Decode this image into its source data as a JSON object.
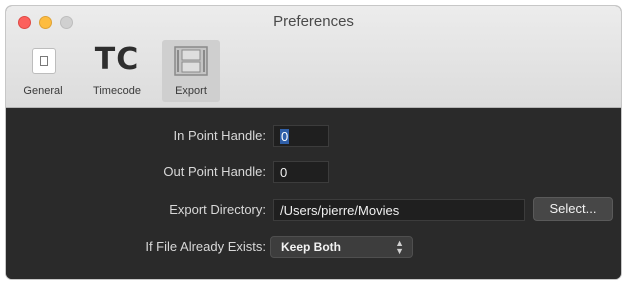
{
  "window": {
    "title": "Preferences"
  },
  "toolbar": {
    "items": [
      {
        "label": "General",
        "icon": "general-icon",
        "selected": false
      },
      {
        "label": "Timecode",
        "icon_text": "TC",
        "icon": "timecode-icon",
        "selected": false
      },
      {
        "label": "Export",
        "icon": "film-icon",
        "selected": true
      }
    ]
  },
  "form": {
    "in_point": {
      "label": "In Point Handle:",
      "value": "0"
    },
    "out_point": {
      "label": "Out Point Handle:",
      "value": "0"
    },
    "export_directory": {
      "label": "Export Directory:",
      "value": "/Users/pierre/Movies",
      "button_label": "Select..."
    },
    "file_exists": {
      "label": "If File Already Exists:",
      "value": "Keep Both"
    }
  },
  "colors": {
    "content_bg": "#2a2a2a",
    "selection": "#2f5fa8",
    "close": "#fc605c",
    "minimize": "#fdbc40",
    "zoom_disabled": "#d0d0d0"
  }
}
